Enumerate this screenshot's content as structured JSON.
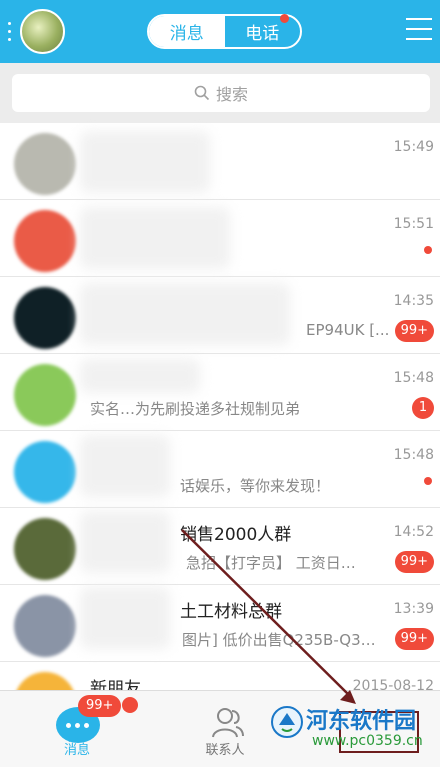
{
  "header": {
    "tab_messages": "消息",
    "tab_calls": "电话"
  },
  "search": {
    "placeholder": "搜索"
  },
  "conversations": [
    {
      "name": "",
      "message": "",
      "time": "15:49",
      "badge": "",
      "dot": false,
      "avatar_color": "#b9b9b0"
    },
    {
      "name": "",
      "message": "",
      "time": "15:51",
      "badge": "",
      "dot": true,
      "avatar_color": "#ea5b47"
    },
    {
      "name": "",
      "message": "EP94UK [...",
      "time": "14:35",
      "badge": "99+",
      "dot": false,
      "avatar_color": "#0f2026"
    },
    {
      "name": "",
      "message": "实名…为先刷投递多社规制见弟",
      "time": "15:48",
      "badge": "1",
      "dot": false,
      "avatar_color": "#8ac95a"
    },
    {
      "name": "",
      "message": "话娱乐，等你来发现！",
      "time": "15:48",
      "badge": "",
      "dot": true,
      "avatar_color": "#35b7ea"
    },
    {
      "name": "销售2000人群",
      "message": "急招【打字员】 工资日…",
      "time": "14:52",
      "badge": "99+",
      "dot": false,
      "avatar_color": "#5a6a3a"
    },
    {
      "name": "土工材料总群",
      "message": "图片] 低价出售Q235B-Q3…",
      "time": "13:39",
      "badge": "99+",
      "dot": false,
      "avatar_color": "#8a94a6"
    },
    {
      "name": "新朋友",
      "message": "",
      "time": "2015-08-12",
      "badge": "",
      "dot": false,
      "avatar_color": "#f5b43a"
    }
  ],
  "tabbar": {
    "messages_label": "消息",
    "messages_badge": "99+",
    "contacts_label": "联系人"
  },
  "watermark": {
    "name": "河东软件园",
    "url": "www.pc0359.cn"
  },
  "colors": {
    "accent": "#2ab4e8",
    "badge": "#f04a3a"
  }
}
